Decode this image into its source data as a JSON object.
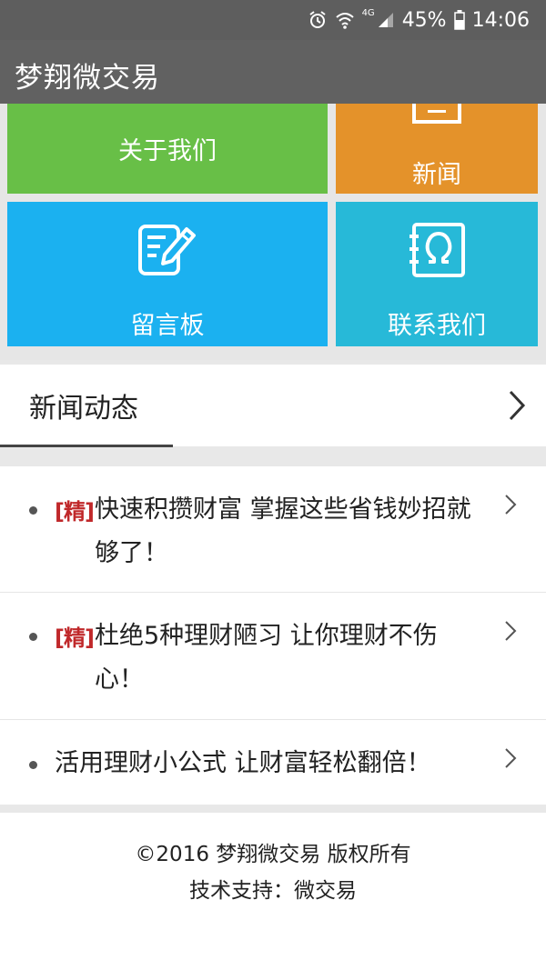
{
  "status_bar": {
    "network": "4G",
    "battery": "45%",
    "time": "14:06",
    "icons": [
      "alarm-icon",
      "wifi-icon",
      "signal-icon",
      "battery-icon"
    ]
  },
  "app": {
    "title": "梦翔微交易"
  },
  "tiles": {
    "about": {
      "label": "关于我们",
      "color": "#68bf47"
    },
    "news": {
      "label": "新闻",
      "color": "#e4922a",
      "icon": "document-icon"
    },
    "board": {
      "label": "留言板",
      "color": "#1bb1f0",
      "icon": "edit-note-icon"
    },
    "contact": {
      "label": "联系我们",
      "color": "#27b9d8",
      "icon": "contact-card-icon"
    }
  },
  "news_section": {
    "title": "新闻动态",
    "items": [
      {
        "tag": "[精]",
        "text": "快速积攒财富 掌握这些省钱妙招就够了！"
      },
      {
        "tag": "[精]",
        "text": "杜绝5种理财陋习 让你理财不伤心！"
      },
      {
        "tag": "",
        "text": "活用理财小公式 让财富轻松翻倍！"
      }
    ]
  },
  "footer": {
    "copyright": "©2016 梦翔微交易 版权所有",
    "support": "技术支持：微交易"
  }
}
